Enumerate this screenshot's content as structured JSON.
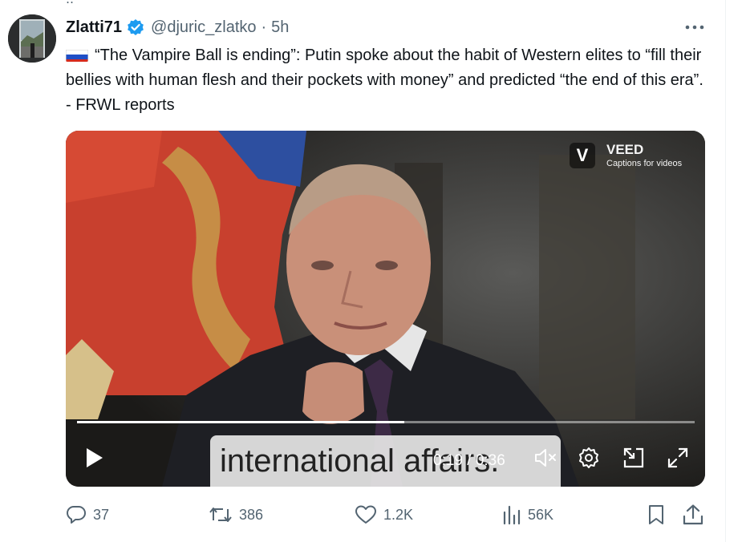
{
  "tweet": {
    "display_name": "Zlatti71",
    "handle": "@djuric_zlatko",
    "separator": "·",
    "time": "5h",
    "text": "“The Vampire Ball is ending”: Putin spoke about the habit of Western elites to “fill their bellies with human flesh and their pockets with money” and predicted “the end of this era”. - FRWL reports"
  },
  "video": {
    "watermark_name": "VEED",
    "watermark_letter": "V",
    "watermark_tagline": "Captions for videos",
    "caption": "international affairs.",
    "time_readout": "0:19 / 0:36",
    "progress_fraction": 0.53
  },
  "actions": {
    "replies": "37",
    "reposts": "386",
    "likes": "1.2K",
    "views": "56K"
  },
  "icons": [
    "verified-badge-icon",
    "more-icon",
    "russia-flag-icon",
    "play-icon",
    "mute-icon",
    "settings-icon",
    "dock-icon",
    "fullscreen-icon",
    "reply-icon",
    "repost-icon",
    "like-icon",
    "views-icon",
    "bookmark-icon",
    "share-icon"
  ],
  "colors": {
    "verified": "#1d9bf0",
    "secondary_text": "#536471"
  }
}
